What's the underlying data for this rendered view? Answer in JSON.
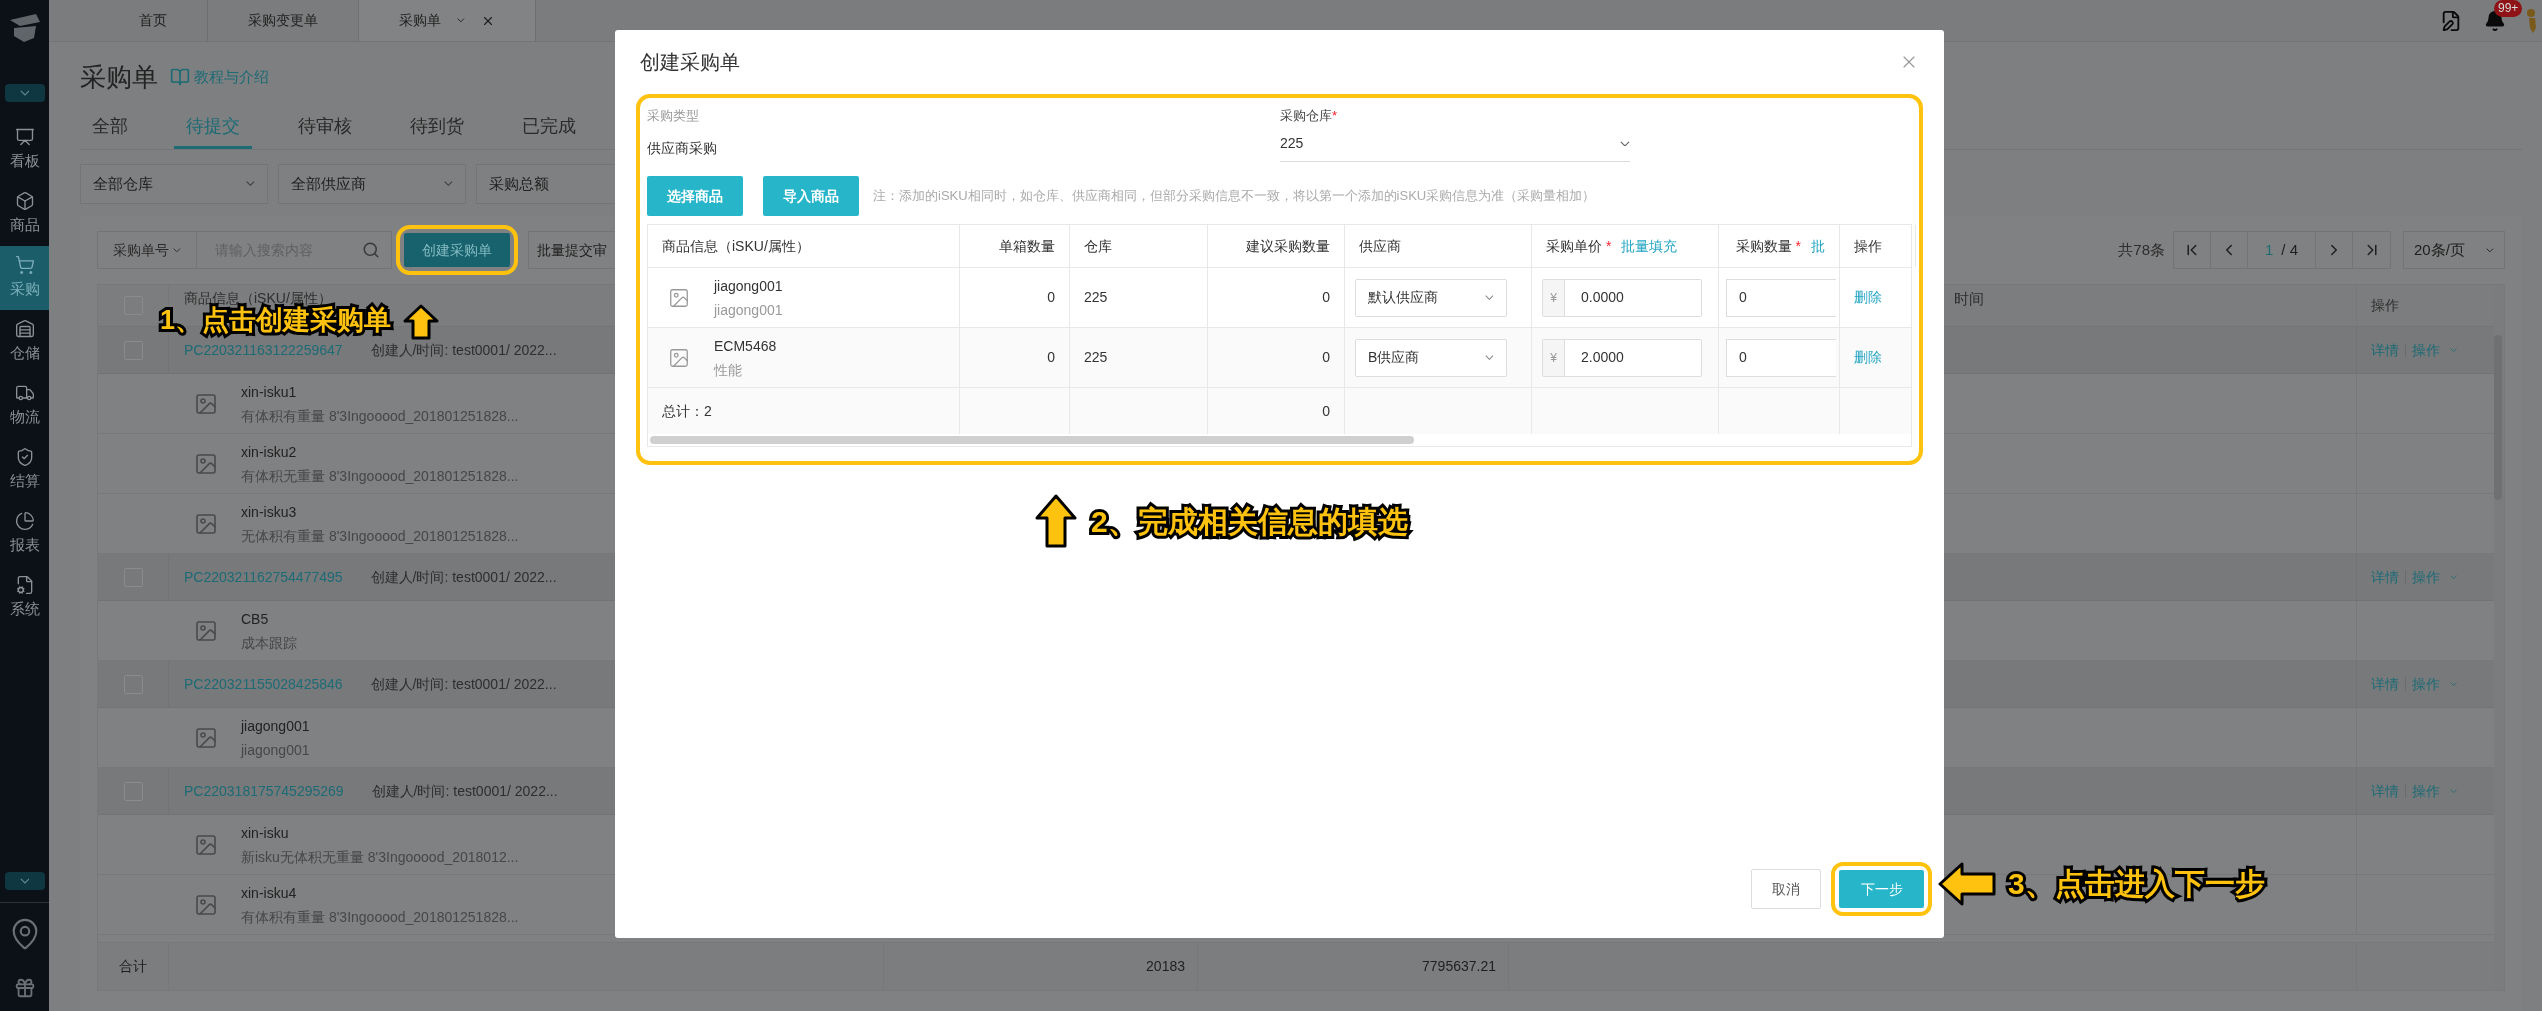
{
  "sidebar": {
    "items": [
      {
        "label": "看板",
        "selected": false
      },
      {
        "label": "商品",
        "selected": false
      },
      {
        "label": "采购",
        "selected": true
      },
      {
        "label": "仓储",
        "selected": false
      },
      {
        "label": "物流",
        "selected": false
      },
      {
        "label": "结算",
        "selected": false
      },
      {
        "label": "报表",
        "selected": false
      },
      {
        "label": "系统",
        "selected": false
      }
    ],
    "toggles": [
      {
        "expanded": false
      },
      {
        "expanded": false
      }
    ]
  },
  "top_tabs": [
    {
      "label": "首页",
      "selected": false
    },
    {
      "label": "采购变更单",
      "selected": false
    },
    {
      "label": "采购单",
      "selected": true
    }
  ],
  "notification_badge": "99+",
  "page": {
    "title": "采购单",
    "help_link": "教程与介绍"
  },
  "status_tabs": [
    {
      "label": "全部",
      "selected": false
    },
    {
      "label": "待提交",
      "selected": true
    },
    {
      "label": "待审核",
      "selected": false
    },
    {
      "label": "待到货",
      "selected": false
    },
    {
      "label": "已完成",
      "selected": false
    }
  ],
  "filters": [
    "全部仓库",
    "全部供应商",
    "采购总额"
  ],
  "search": {
    "field": "采购单号",
    "placeholder": "请输入搜索内容"
  },
  "create_button": "创建采购单",
  "batch_button": "批量提交审",
  "pagination": {
    "total": "共78条",
    "page": "1",
    "pages": "/ 4",
    "page_size": "20条/页"
  },
  "list": {
    "all_checked": false,
    "columns": [
      "商品信息（iSKU/属性）",
      "时间",
      "操作"
    ],
    "groups": [
      {
        "order_no": "PC220321163122259647",
        "creator": "创建人/时间: test0001/ 2022...",
        "checked": false,
        "actions": [
          "详情",
          "操作"
        ],
        "items": [
          {
            "sku": "xin-isku1",
            "attr": "有体积有重量 8'3Ingooood_201801251828..."
          },
          {
            "sku": "xin-isku2",
            "attr": "有体积无重量 8'3Ingooood_201801251828..."
          },
          {
            "sku": "xin-isku3",
            "attr": "无体积有重量 8'3Ingooood_201801251828..."
          }
        ]
      },
      {
        "order_no": "PC220321162754477495",
        "creator": "创建人/时间: test0001/ 2022...",
        "checked": false,
        "actions": [
          "详情",
          "操作"
        ],
        "items": [
          {
            "sku": "CB5",
            "attr": "成本跟踪"
          }
        ]
      },
      {
        "order_no": "PC220321155028425846",
        "creator": "创建人/时间: test0001/ 2022...",
        "checked": false,
        "actions": [
          "详情",
          "操作"
        ],
        "items": [
          {
            "sku": "jiagong001",
            "attr": "jiagong001"
          }
        ]
      },
      {
        "order_no": "PC220318175745295269",
        "creator": "创建人/时间: test0001/ 2022...",
        "checked": false,
        "actions": [
          "详情",
          "操作"
        ],
        "items": [
          {
            "sku": "xin-isku",
            "attr": "新isku无体积无重量 8'3Ingooood_2018012..."
          },
          {
            "sku": "xin-isku4",
            "attr": "有体积有重量 8'3Ingooood_201801251828..."
          }
        ]
      }
    ],
    "total": {
      "label": "合计",
      "values": [
        "20183",
        "7795637.21"
      ]
    }
  },
  "dialog": {
    "title": "创建采购单",
    "type_label": "采购类型",
    "type_value": "供应商采购",
    "warehouse_label": "采购仓库",
    "warehouse_mark": "*",
    "warehouse_value": "225",
    "buttons": [
      "选择商品",
      "导入商品"
    ],
    "note": "注：添加的iSKU相同时，如仓库、供应商相同，但部分采购信息不一致，将以第一个添加的iSKU采购信息为准（采购量相加）",
    "table": {
      "columns": [
        {
          "label": "商品信息（iSKU/属性）"
        },
        {
          "label": "单箱数量"
        },
        {
          "label": "仓库"
        },
        {
          "label": "建议采购数量"
        },
        {
          "label": "供应商"
        },
        {
          "label": "采购单价",
          "mark": "*",
          "link": "批量填充"
        },
        {
          "label": "采购数量",
          "mark": "*",
          "link": "批"
        },
        {
          "label": "操作"
        }
      ],
      "rows": [
        {
          "sku": "jiagong001",
          "attr": "jiagong001",
          "box_qty": "0",
          "warehouse": "225",
          "suggested": "0",
          "supplier": "默认供应商",
          "currency": "¥",
          "price": "0.0000",
          "qty": "0",
          "action": "删除"
        },
        {
          "sku": "ECM5468",
          "attr": "性能",
          "box_qty": "0",
          "warehouse": "225",
          "suggested": "0",
          "supplier": "B供应商",
          "currency": "¥",
          "price": "2.0000",
          "qty": "0",
          "action": "删除"
        }
      ],
      "total": {
        "label": "总计：2",
        "suggested": "0"
      }
    },
    "footer": [
      "取消",
      "下一步"
    ]
  },
  "annotations": [
    {
      "kind": "up",
      "text": "1、点击创建采购单"
    },
    {
      "kind": "up",
      "text": "2、完成相关信息的填选"
    },
    {
      "kind": "left",
      "text": "3、点击进入下一步"
    }
  ]
}
